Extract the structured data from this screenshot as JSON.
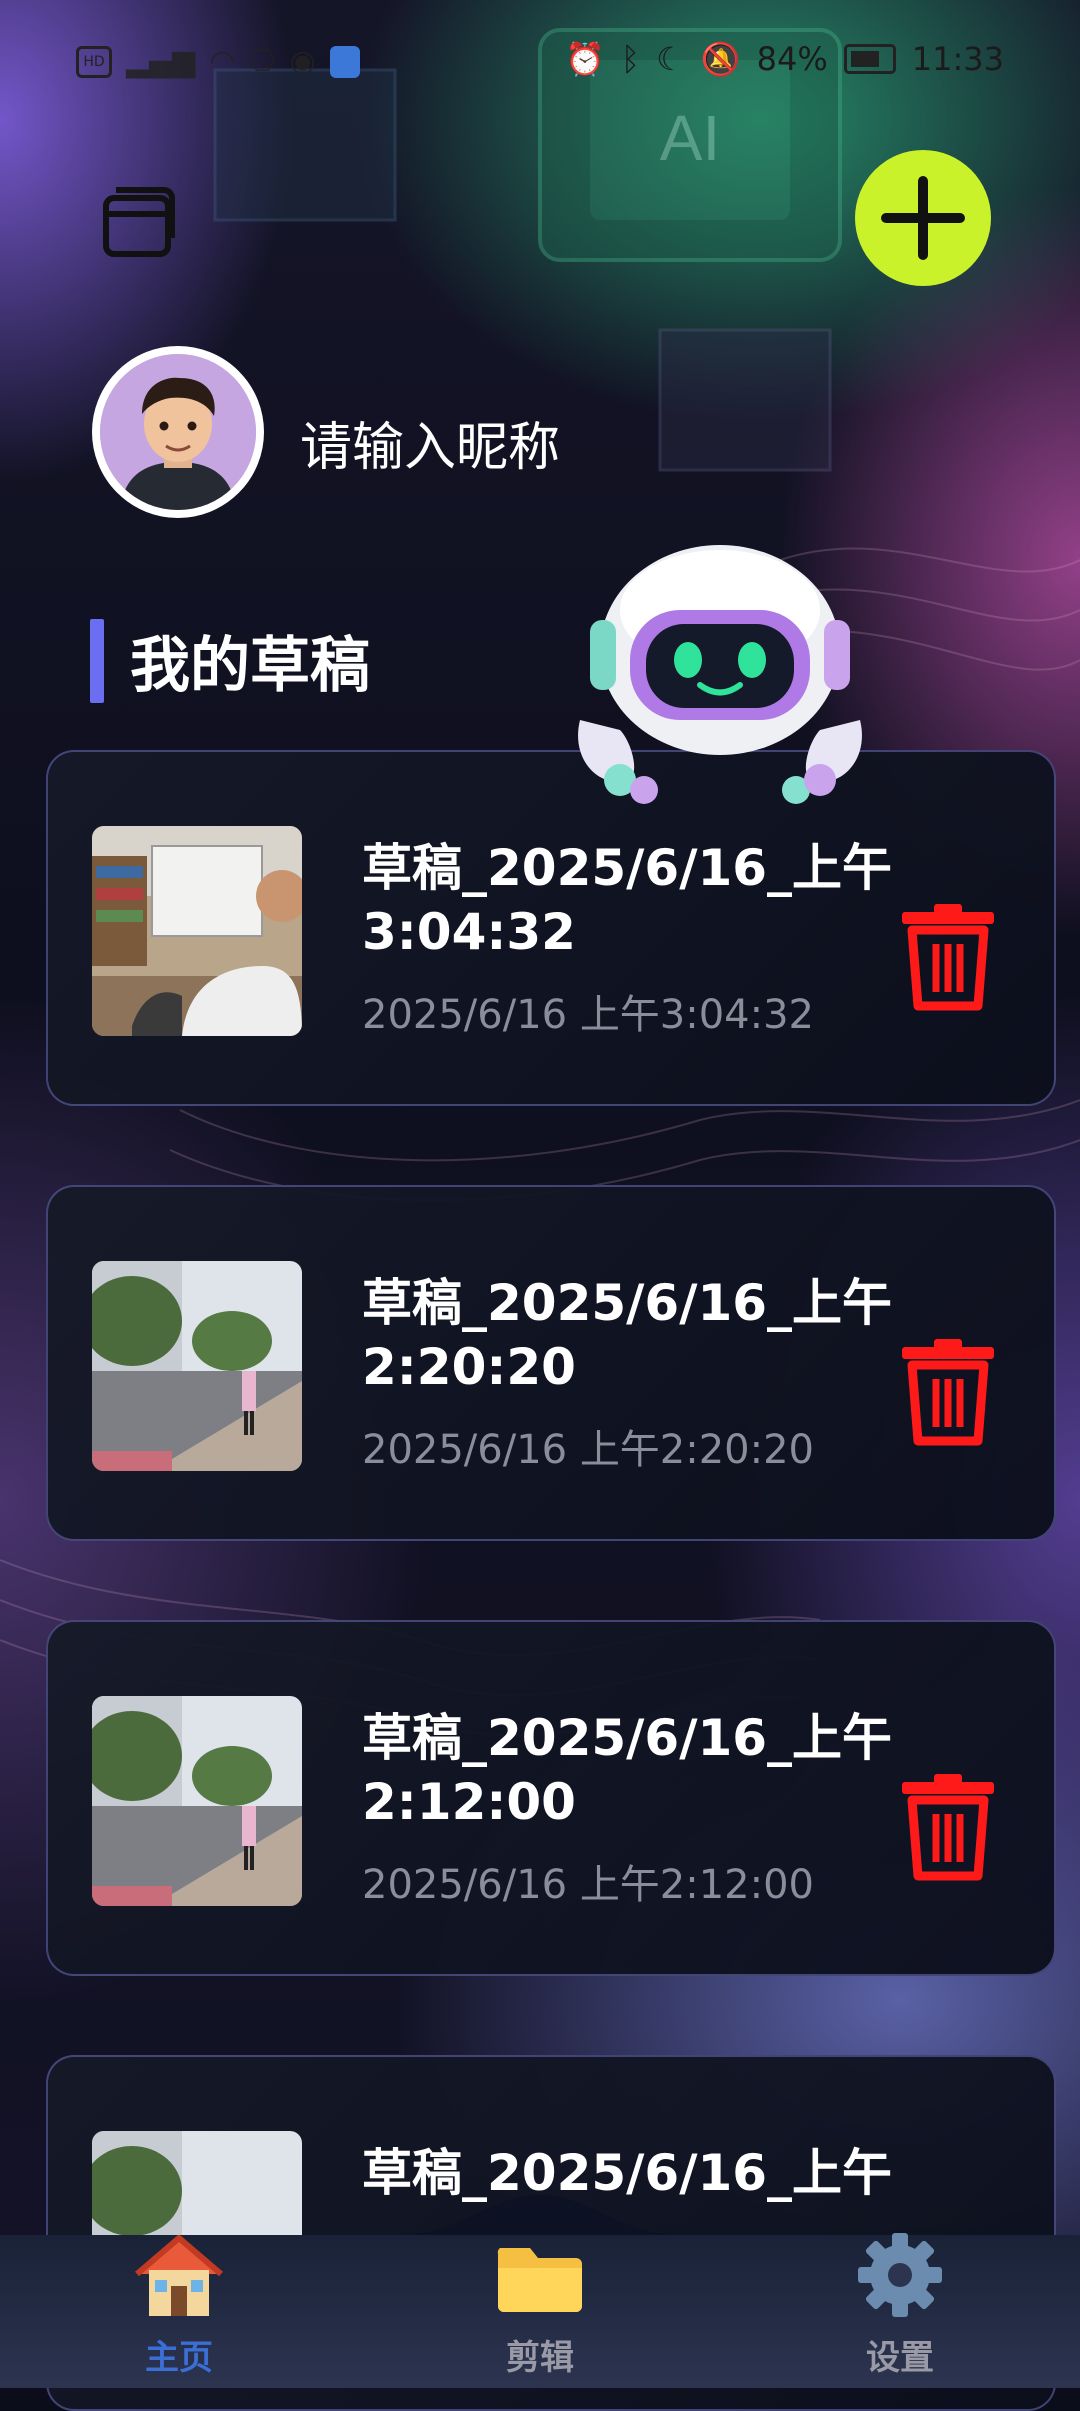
{
  "status_bar": {
    "battery_text": "84%",
    "time": "11:33"
  },
  "profile": {
    "nickname": "请输入昵称"
  },
  "section": {
    "title": "我的草稿"
  },
  "drafts": [
    {
      "name": "草稿_2025/6/16_上午3:04:32",
      "date": "2025/6/16 上午3:04:32"
    },
    {
      "name": "草稿_2025/6/16_上午2:20:20",
      "date": "2025/6/16 上午2:20:20"
    },
    {
      "name": "草稿_2025/6/16_上午2:12:00",
      "date": "2025/6/16 上午2:12:00"
    },
    {
      "name": "草稿_2025/6/16_上午",
      "date": ""
    }
  ],
  "tabs": [
    {
      "label": "主页",
      "icon": "home-icon",
      "active": true
    },
    {
      "label": "剪辑",
      "icon": "folder-icon",
      "active": false
    },
    {
      "label": "设置",
      "icon": "gear-icon",
      "active": false
    }
  ],
  "colors": {
    "accent": "#6b6ef0",
    "add_button": "#c9f22a",
    "delete": "#ff1a1a",
    "active_tab": "#3b6fd6",
    "inactive_tab": "#9a9aa6"
  }
}
